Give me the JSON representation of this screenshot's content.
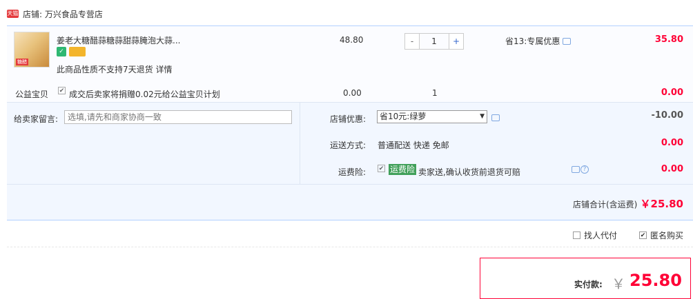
{
  "shop": {
    "badge": "天猫",
    "name": "店铺: 万兴食品专营店"
  },
  "item": {
    "title": "姜老大糖醋蒜糖蒜甜蒜腌泡大蒜...",
    "image_stamp": "糖醋",
    "note": "此商品性质不支持7天退货 详情",
    "unit_price": "48.80",
    "qty_minus": "-",
    "qty_value": "1",
    "qty_plus": "+",
    "promo": "省13:专属优惠",
    "total": "35.80"
  },
  "charity": {
    "label": "公益宝贝",
    "check": "✔",
    "text": "成交后卖家将捐赠0.02元给公益宝贝计划",
    "price": "0.00",
    "qty": "1",
    "total": "0.00"
  },
  "message": {
    "label": "给卖家留言:",
    "placeholder": "选填,请先和商家协商一致"
  },
  "discount": {
    "label": "店铺优惠:",
    "selected": "省10元:绿萝",
    "value": "-10.00"
  },
  "shipping": {
    "label": "运送方式:",
    "value": "普通配送 快递 免邮",
    "total": "0.00"
  },
  "insurance": {
    "label": "运费险:",
    "check": "✔",
    "badge": "运费险",
    "text": "卖家送,确认收货前退货可赔",
    "help": "?",
    "total": "0.00"
  },
  "subtotal": {
    "label": "店铺合计(含运费)",
    "value": "￥25.80"
  },
  "options": {
    "proxy_pay": "找人代付",
    "anonymous": "匿名购买",
    "anonymous_check": "✔"
  },
  "payment": {
    "label": "实付款:",
    "currency": "￥",
    "value": "25.80"
  },
  "colors": {
    "accent": "#ff0036",
    "border": "#b2d1ff",
    "panel": "#f2f7ff",
    "insurance": "#41a05a"
  }
}
